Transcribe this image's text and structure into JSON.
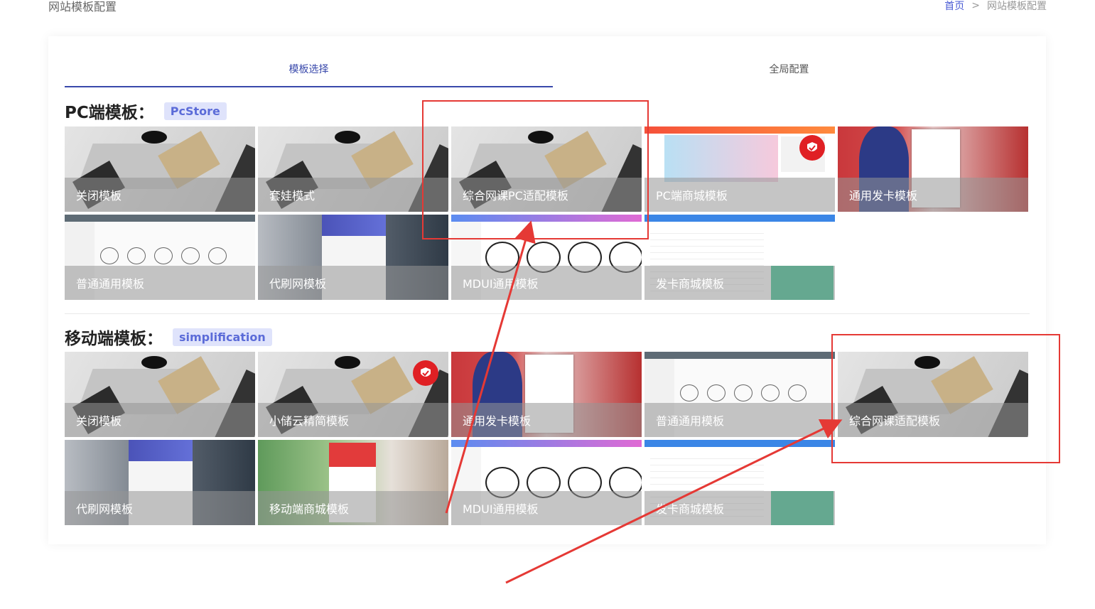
{
  "header": {
    "page_title": "网站模板配置",
    "breadcrumb": {
      "home": "首页",
      "separator": ">",
      "current": "网站模板配置"
    }
  },
  "tabs": [
    {
      "label": "模板选择",
      "active": true
    },
    {
      "label": "全局配置",
      "active": false
    }
  ],
  "pc_section": {
    "title": "PC端模板：",
    "current_badge": "PcStore",
    "templates": [
      {
        "label": "关闭模板",
        "thumb": "desk",
        "selected": false
      },
      {
        "label": "套娃模式",
        "thumb": "desk",
        "selected": false
      },
      {
        "label": "综合网课PC适配模板",
        "thumb": "desk",
        "selected": false
      },
      {
        "label": "PC端商城模板",
        "thumb": "shop",
        "selected": true
      },
      {
        "label": "通用发卡模板",
        "thumb": "anime",
        "selected": false
      },
      {
        "label": "普通通用模板",
        "thumb": "admin",
        "selected": false
      },
      {
        "label": "代刷网模板",
        "thumb": "dai",
        "selected": false
      },
      {
        "label": "MDUI通用模板",
        "thumb": "mdui",
        "selected": false
      },
      {
        "label": "发卡商城模板",
        "thumb": "fk",
        "selected": false
      }
    ]
  },
  "mobile_section": {
    "title": "移动端模板：",
    "current_badge": "simplification",
    "templates": [
      {
        "label": "关闭模板",
        "thumb": "desk",
        "selected": false
      },
      {
        "label": "小储云精简模板",
        "thumb": "desk",
        "selected": true
      },
      {
        "label": "通用发卡模板",
        "thumb": "anime",
        "selected": false
      },
      {
        "label": "普通通用模板",
        "thumb": "admin",
        "selected": false
      },
      {
        "label": "综合网课适配模板",
        "thumb": "desk",
        "selected": false
      },
      {
        "label": "代刷网模板",
        "thumb": "dai",
        "selected": false
      },
      {
        "label": "移动端商城模板",
        "thumb": "mshop",
        "selected": false
      },
      {
        "label": "MDUI通用模板",
        "thumb": "mdui",
        "selected": false
      },
      {
        "label": "发卡商城模板",
        "thumb": "fk",
        "selected": false
      }
    ]
  },
  "colors": {
    "accent": "#3949ab",
    "badge_bg": "#dfe3fb",
    "badge_text": "#5b6bd8",
    "selected_check": "#e02024",
    "annotation": "#e53935"
  }
}
